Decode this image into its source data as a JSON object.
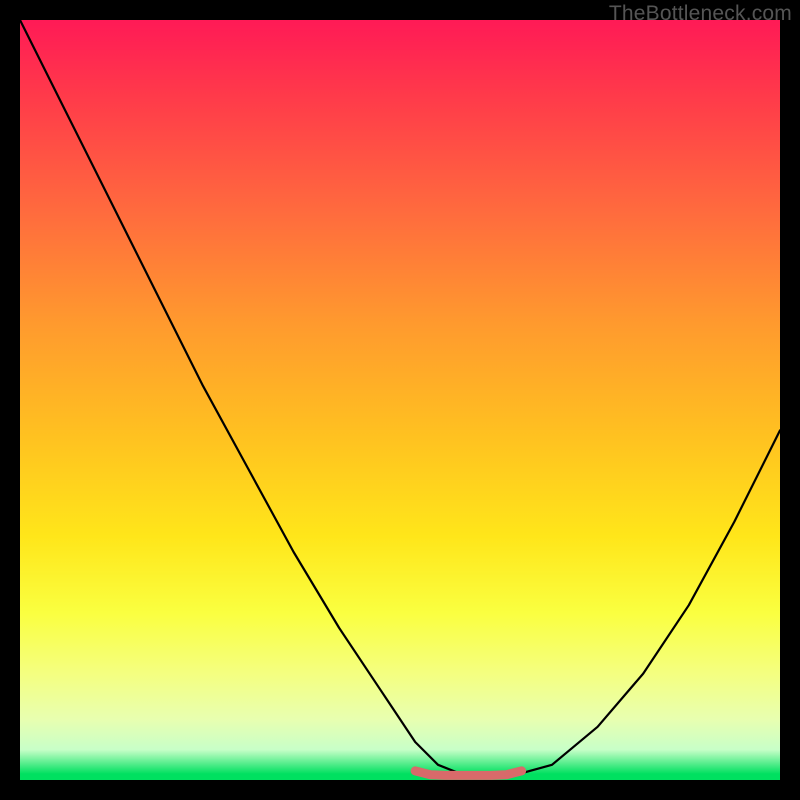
{
  "credit": "TheBottleneck.com",
  "colors": {
    "credit": "#555555",
    "curve": "#000000",
    "floor_marker": "#d86a6a",
    "gradient_top": "#ff1a56",
    "gradient_bottom": "#00e060",
    "frame": "#000000"
  },
  "chart_data": {
    "type": "line",
    "title": "",
    "xlabel": "",
    "ylabel": "",
    "xlim": [
      0,
      100
    ],
    "ylim": [
      0,
      100
    ],
    "grid": false,
    "legend": false,
    "annotations": [
      {
        "text": "TheBottleneck.com",
        "pos": "top-right"
      }
    ],
    "series": [
      {
        "name": "bottleneck-curve",
        "x": [
          0,
          6,
          12,
          18,
          24,
          30,
          36,
          42,
          48,
          52,
          55,
          58,
          60,
          63,
          66,
          70,
          76,
          82,
          88,
          94,
          100
        ],
        "values": [
          100,
          88,
          76,
          64,
          52,
          41,
          30,
          20,
          11,
          5,
          2,
          0.8,
          0.6,
          0.6,
          0.9,
          2,
          7,
          14,
          23,
          34,
          46
        ]
      },
      {
        "name": "floor-marker",
        "x": [
          52,
          54,
          56,
          58,
          60,
          62,
          64,
          66
        ],
        "values": [
          1.2,
          0.7,
          0.6,
          0.6,
          0.6,
          0.6,
          0.7,
          1.2
        ]
      }
    ]
  }
}
